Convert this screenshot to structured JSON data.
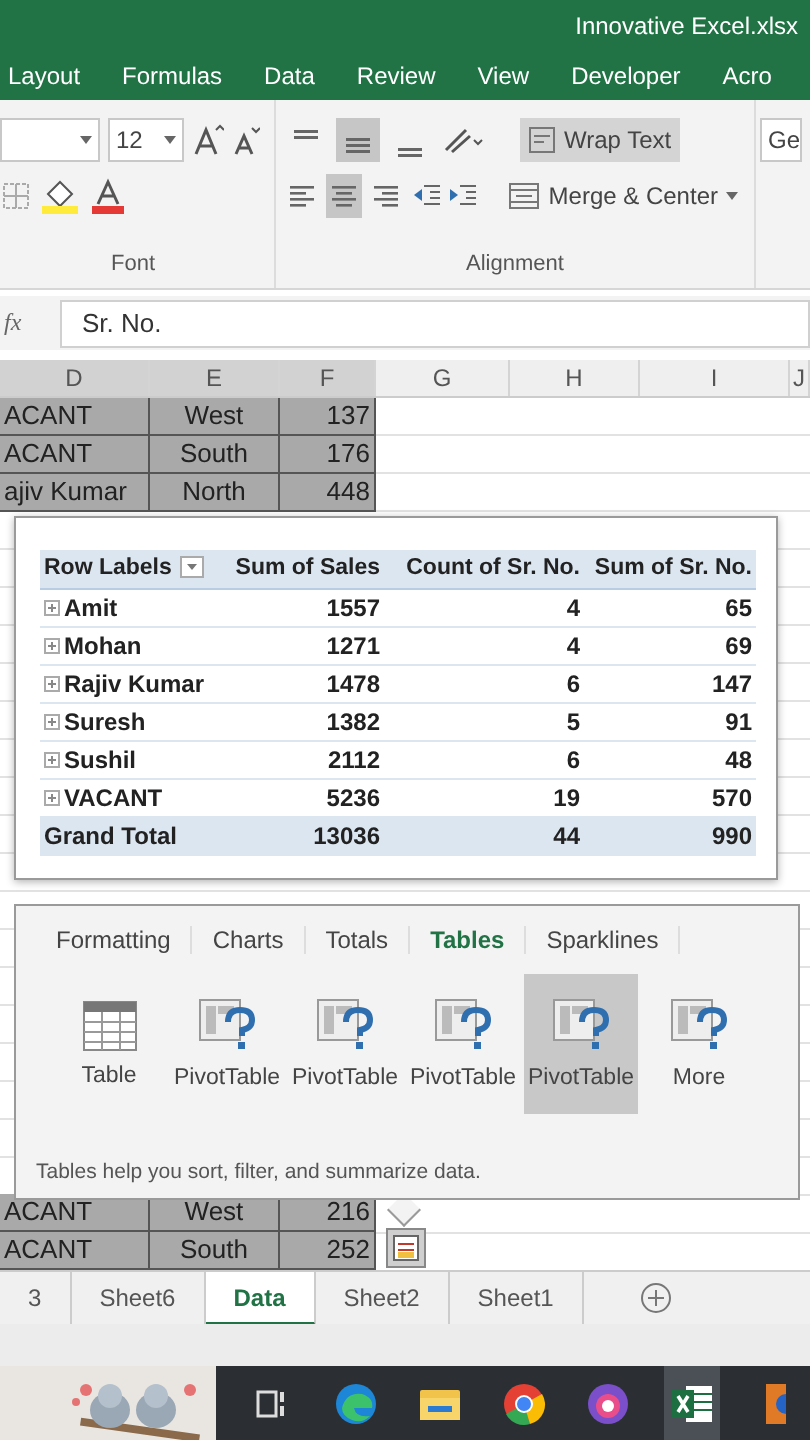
{
  "window": {
    "title": "Innovative Excel.xlsx"
  },
  "ribbon_tabs": [
    {
      "label": "Layout",
      "selected": false
    },
    {
      "label": "Formulas",
      "selected": false
    },
    {
      "label": "Data",
      "selected": false
    },
    {
      "label": "Review",
      "selected": false
    },
    {
      "label": "View",
      "selected": false
    },
    {
      "label": "Developer",
      "selected": false
    },
    {
      "label": "Acro",
      "selected": false
    }
  ],
  "ribbon": {
    "font_size": "12",
    "vertical_align": [
      {
        "kind": "top",
        "selected": false
      },
      {
        "kind": "middle",
        "selected": true
      },
      {
        "kind": "bottom",
        "selected": false
      }
    ],
    "horizontal_align": [
      {
        "kind": "left",
        "selected": false
      },
      {
        "kind": "center",
        "selected": true
      },
      {
        "kind": "right",
        "selected": false
      }
    ],
    "wrap_text": {
      "label": "Wrap Text",
      "on": true
    },
    "merge_center": "Merge & Center",
    "number_format": "Ge",
    "groups": [
      "Font",
      "Alignment"
    ]
  },
  "formula_bar": {
    "function_label": "fx",
    "value": "Sr. No."
  },
  "columns": [
    "D",
    "E",
    "F",
    "G",
    "H",
    "I",
    "J"
  ],
  "top_rows": [
    [
      "ACANT",
      "West",
      "137"
    ],
    [
      "ACANT",
      "South",
      "176"
    ],
    [
      "ajiv Kumar",
      "North",
      "448"
    ]
  ],
  "bottom_rows": [
    [
      "ACANT",
      "West",
      "216"
    ],
    [
      "ACANT",
      "South",
      "252"
    ]
  ],
  "pivot": {
    "columns": [
      "Row Labels",
      "Sum of Sales",
      "Count of Sr. No.",
      "Sum of Sr. No."
    ],
    "rows": [
      {
        "label": "Amit",
        "values": [
          "1557",
          "4",
          "65"
        ]
      },
      {
        "label": "Mohan",
        "values": [
          "1271",
          "4",
          "69"
        ]
      },
      {
        "label": "Rajiv Kumar",
        "values": [
          "1478",
          "6",
          "147"
        ]
      },
      {
        "label": "Suresh",
        "values": [
          "1382",
          "5",
          "91"
        ]
      },
      {
        "label": "Sushil",
        "values": [
          "2112",
          "6",
          "48"
        ]
      },
      {
        "label": "VACANT",
        "values": [
          "5236",
          "19",
          "570"
        ]
      }
    ],
    "total": {
      "label": "Grand Total",
      "values": [
        "13036",
        "44",
        "990"
      ]
    }
  },
  "quick_analysis": {
    "tabs": [
      {
        "label": "Formatting",
        "selected": false
      },
      {
        "label": "Charts",
        "selected": false
      },
      {
        "label": "Totals",
        "selected": false
      },
      {
        "label": "Tables",
        "selected": true
      },
      {
        "label": "Sparklines",
        "selected": false
      }
    ],
    "items": [
      {
        "kind": "table",
        "label": "Table",
        "selected": false
      },
      {
        "kind": "pivot",
        "label": "PivotTable",
        "selected": false
      },
      {
        "kind": "pivot",
        "label": "PivotTable",
        "selected": false
      },
      {
        "kind": "pivot",
        "label": "PivotTable",
        "selected": false
      },
      {
        "kind": "pivot",
        "label": "PivotTable",
        "selected": true
      },
      {
        "kind": "more",
        "label": "More",
        "selected": false
      }
    ],
    "description": "Tables help you sort, filter, and summarize data."
  },
  "sheet_tabs": [
    {
      "label": "3",
      "selected": false
    },
    {
      "label": "Sheet6",
      "selected": false
    },
    {
      "label": "Data",
      "selected": true
    },
    {
      "label": "Sheet2",
      "selected": false
    },
    {
      "label": "Sheet1",
      "selected": false
    }
  ],
  "taskbar": [
    {
      "kind": "taskview",
      "active": false
    },
    {
      "kind": "edge",
      "active": false
    },
    {
      "kind": "explorer",
      "active": false
    },
    {
      "kind": "chrome",
      "active": false
    },
    {
      "kind": "app",
      "active": false
    },
    {
      "kind": "excel",
      "active": true
    },
    {
      "kind": "partial",
      "active": false
    }
  ]
}
